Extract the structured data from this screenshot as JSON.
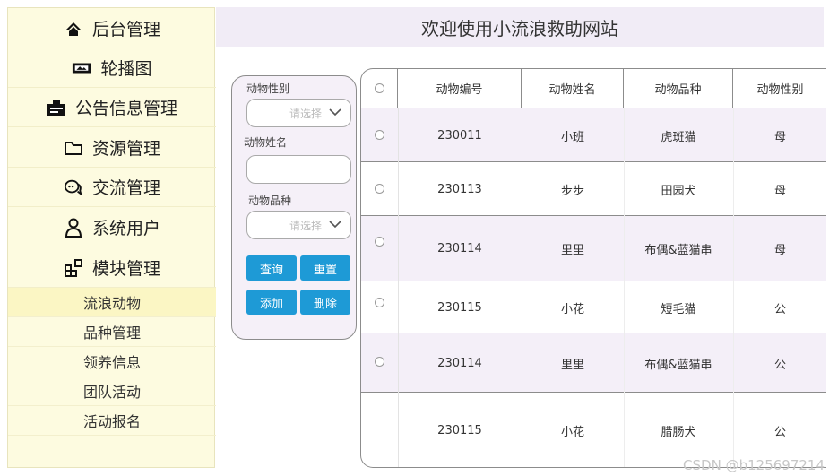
{
  "sidebar": {
    "items": [
      {
        "label": "后台管理",
        "icon": "home-icon"
      },
      {
        "label": "轮播图",
        "icon": "carousel-icon"
      },
      {
        "label": "公告信息管理",
        "icon": "announcement-icon"
      },
      {
        "label": "资源管理",
        "icon": "folder-icon"
      },
      {
        "label": "交流管理",
        "icon": "chat-icon"
      },
      {
        "label": "系统用户",
        "icon": "user-icon"
      },
      {
        "label": "模块管理",
        "icon": "modules-icon"
      }
    ],
    "sub_items": [
      "流浪动物",
      "品种管理",
      "领养信息",
      "团队活动",
      "活动报名"
    ],
    "active_sub": "流浪动物"
  },
  "header": {
    "title": "欢迎使用小流浪救助网站"
  },
  "filter": {
    "gender_label": "动物性别",
    "gender_placeholder": "请选择",
    "name_label": "动物姓名",
    "name_value": "",
    "breed_label": "动物品种",
    "breed_placeholder": "请选择",
    "search_button": "查询",
    "reset_button": "重置",
    "add_button": "添加",
    "delete_button": "删除"
  },
  "table": {
    "columns": [
      "动物编号",
      "动物姓名",
      "动物品种",
      "动物性别"
    ],
    "rows": [
      {
        "id": "230011",
        "name": "小班",
        "breed": "虎斑猫",
        "gender": "母"
      },
      {
        "id": "230113",
        "name": "步步",
        "breed": "田园犬",
        "gender": "母"
      },
      {
        "id": "230114",
        "name": "里里",
        "breed": "布偶&蓝猫串",
        "gender": "母"
      },
      {
        "id": "230115",
        "name": "小花",
        "breed": "短毛猫",
        "gender": "公"
      },
      {
        "id": "230114",
        "name": "里里",
        "breed": "布偶&蓝猫串",
        "gender": "公"
      },
      {
        "id": "230115",
        "name": "小花",
        "breed": "腊肠犬",
        "gender": "公"
      }
    ]
  },
  "watermark": "CSDN @b125697214",
  "colors": {
    "sidebar_bg": "#fdfbe0",
    "header_bg": "#f1ecf6",
    "button": "#1e9ad6",
    "row_alt": "#f4eff8"
  }
}
